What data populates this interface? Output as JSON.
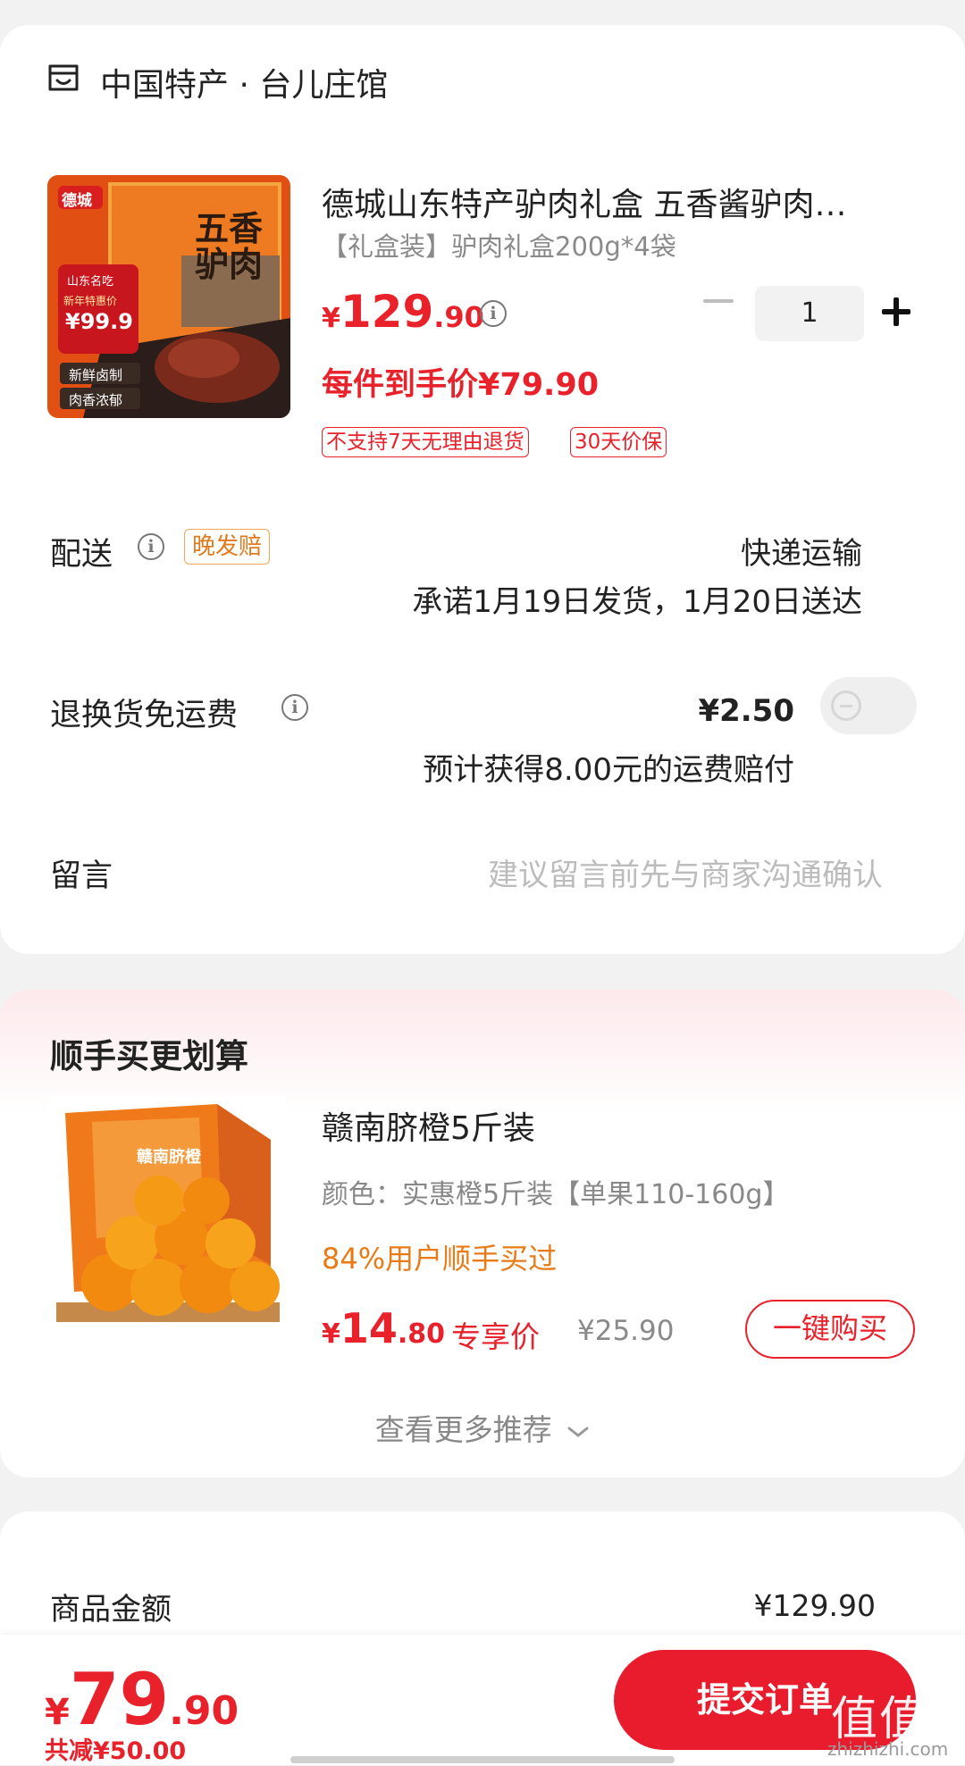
{
  "store": {
    "icon": "store-icon",
    "name": "中国特产 · 台儿庄馆"
  },
  "product": {
    "image_brand": "德城",
    "image_box_text": "五香驴肉",
    "image_badge_top": "山东名吃",
    "image_badge_mid": "新年特惠价",
    "image_badge_price": "¥99.9",
    "image_tag1": "新鲜卤制",
    "image_tag2": "肉香浓郁",
    "title": "德城山东特产驴肉礼盒 五香酱驴肉…",
    "spec": "【礼盒装】驴肉礼盒200g*4袋",
    "price_currency": "¥",
    "price_int": "129",
    "price_dec": ".90",
    "quantity": "1",
    "deal_price": "每件到手价¥79.90",
    "tags": [
      "不支持7天无理由退货",
      "30天价保"
    ]
  },
  "delivery": {
    "label": "配送",
    "badge": "晚发赔",
    "method": "快递运输",
    "promise": "承诺1月19日发货，1月20日送达"
  },
  "return_shipping": {
    "label": "退换货免运费",
    "price": "¥2.50",
    "compensation": "预计获得8.00元的运费赔付",
    "toggle_on": false
  },
  "note": {
    "label": "留言",
    "placeholder": "建议留言前先与商家沟通确认"
  },
  "recommend": {
    "title": "顺手买更划算",
    "image_text": "赣南脐橙",
    "item_title": "赣南脐橙5斤装",
    "item_spec": "颜色：实惠橙5斤装【单果110-160g】",
    "social": "84%用户顺手买过",
    "price_currency": "¥",
    "price_int": "14",
    "price_dec": ".80",
    "exclusive_label": "专享价",
    "original_price": "¥25.90",
    "buy_button": "一键购买",
    "see_more": "查看更多推荐"
  },
  "summary": {
    "label": "商品金额",
    "value": "¥129.90"
  },
  "checkout": {
    "total_currency": "¥",
    "total_int": "79",
    "total_dec": ".90",
    "saved": "共减¥50.00",
    "submit": "提交订单"
  },
  "watermark": {
    "main": "值值值",
    "sub": "zhizhizhi.com"
  },
  "colors": {
    "accent": "#e8212b",
    "orange": "#e87b15",
    "background": "#f2f2f2"
  }
}
